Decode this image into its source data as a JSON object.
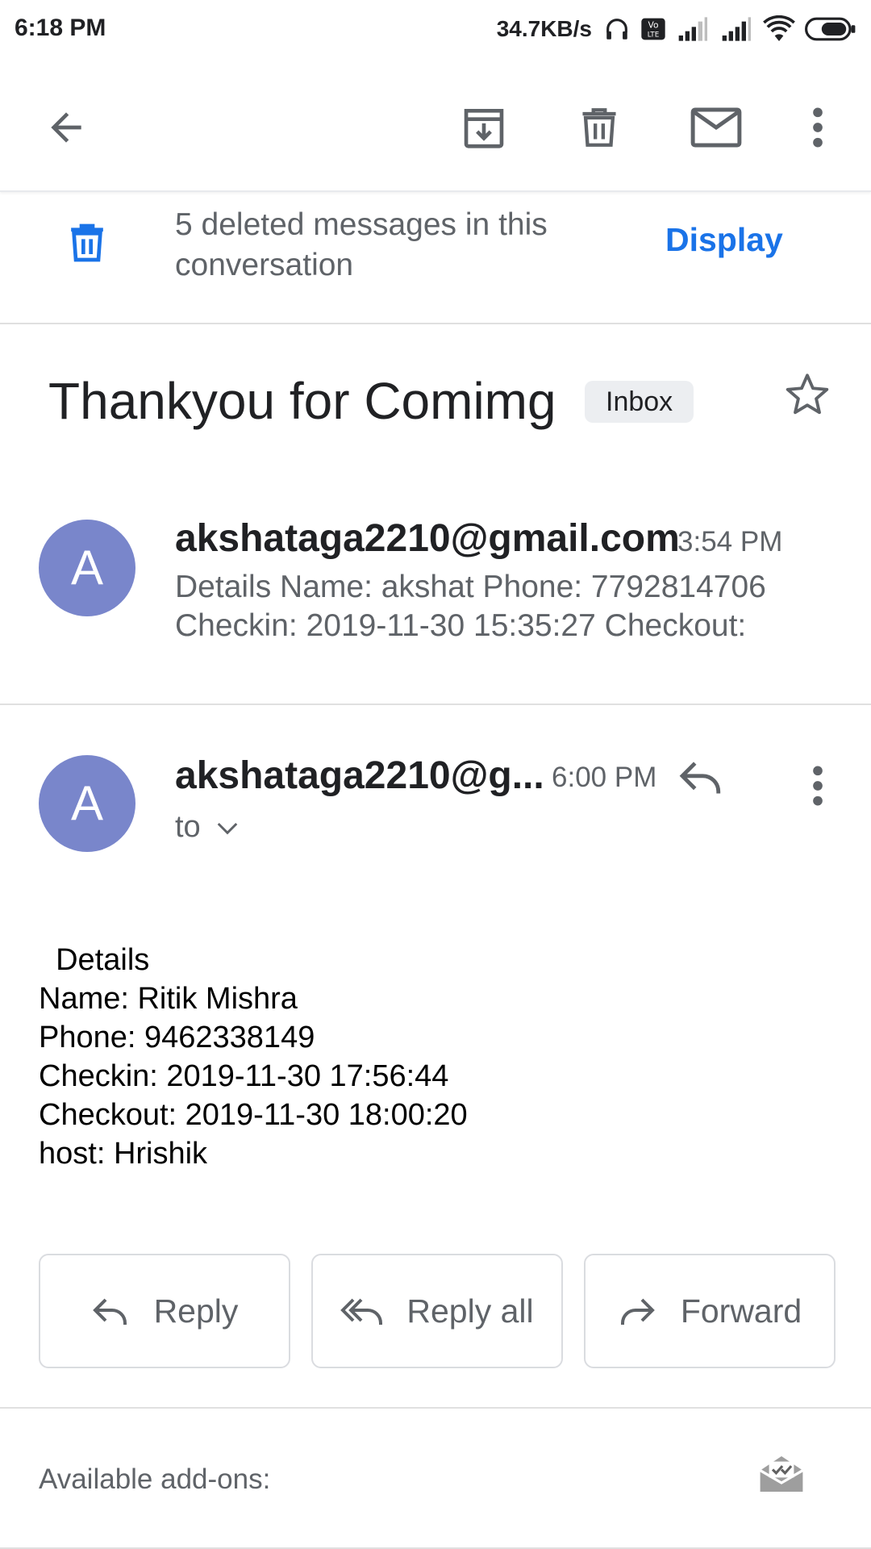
{
  "status_bar": {
    "time": "6:18 PM",
    "network_speed": "34.7KB/s",
    "icons": [
      "headset-icon",
      "volte-icon",
      "signal-icon",
      "signal-icon",
      "wifi-icon",
      "battery-icon"
    ]
  },
  "app_bar": {
    "icons": [
      "back-arrow-icon",
      "archive-icon",
      "delete-icon",
      "mark-unread-icon",
      "more-vert-icon"
    ]
  },
  "deleted_banner": {
    "text": "5 deleted messages in this conversation",
    "action": "Display"
  },
  "subject": {
    "title": "Thankyou for Comimg",
    "label": "Inbox"
  },
  "messages": [
    {
      "avatar_letter": "A",
      "sender": "akshataga2210@gmail.com",
      "time": "3:54 PM",
      "snippet_line1": "Details Name: akshat Phone: 7792814706",
      "snippet_line2": "Checkin: 2019-11-30 15:35:27 Checkout:"
    },
    {
      "avatar_letter": "A",
      "sender": "akshataga2210@g...",
      "time": "6:00 PM",
      "recipient_label": "to",
      "body_lines": [
        "  Details",
        "Name: Ritik Mishra",
        "Phone: 9462338149",
        "Checkin: 2019-11-30 17:56:44",
        "Checkout: 2019-11-30 18:00:20",
        "host: Hrishik"
      ]
    }
  ],
  "actions": {
    "reply": "Reply",
    "reply_all": "Reply all",
    "forward": "Forward"
  },
  "addons": {
    "label": "Available add-ons:"
  },
  "colors": {
    "accent": "#1a73e8",
    "avatar": "#7986cb",
    "secondary_text": "#5f6368"
  }
}
